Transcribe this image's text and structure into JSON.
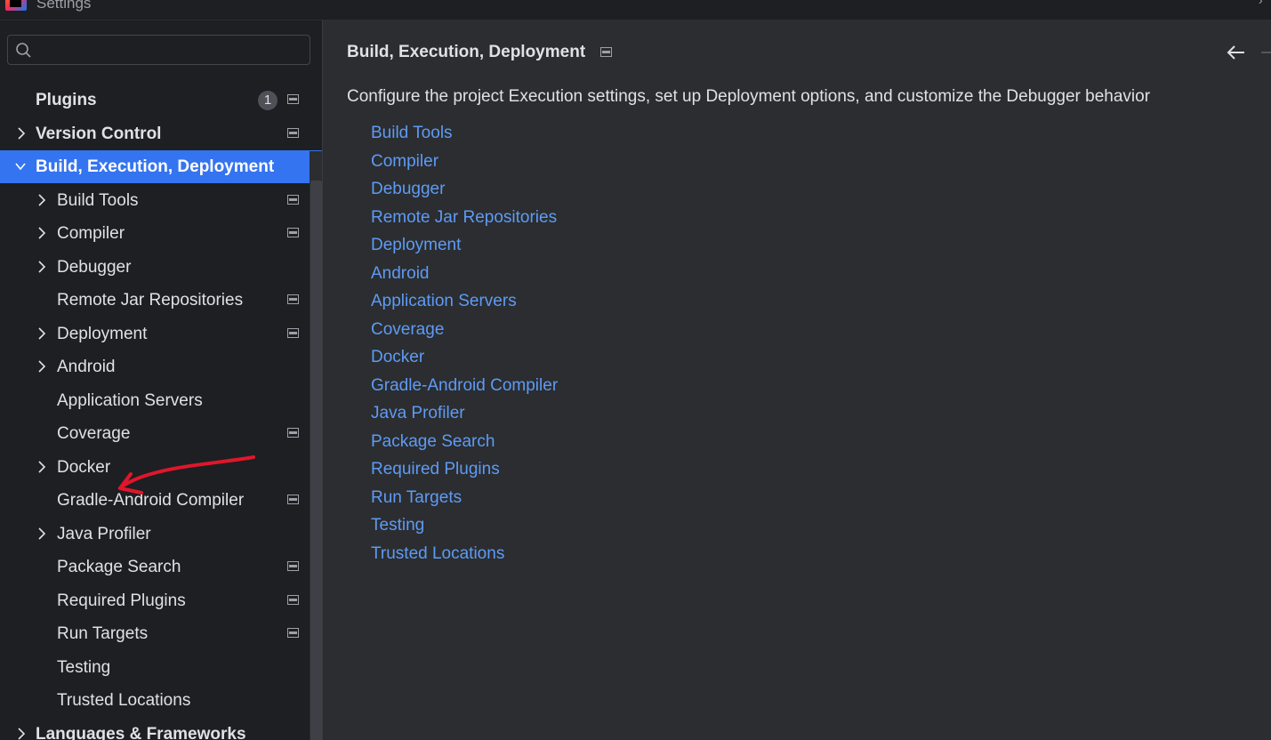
{
  "window": {
    "title": "Settings"
  },
  "search": {
    "placeholder": "",
    "value": ""
  },
  "sidebar": {
    "items": [
      {
        "label": "Plugins",
        "badge": "1"
      },
      {
        "label": "Version Control"
      },
      {
        "label": "Build, Execution, Deployment"
      },
      {
        "label": "Build Tools"
      },
      {
        "label": "Compiler"
      },
      {
        "label": "Debugger"
      },
      {
        "label": "Remote Jar Repositories"
      },
      {
        "label": "Deployment"
      },
      {
        "label": "Android"
      },
      {
        "label": "Application Servers"
      },
      {
        "label": "Coverage"
      },
      {
        "label": "Docker"
      },
      {
        "label": "Gradle-Android Compiler"
      },
      {
        "label": "Java Profiler"
      },
      {
        "label": "Package Search"
      },
      {
        "label": "Required Plugins"
      },
      {
        "label": "Run Targets"
      },
      {
        "label": "Testing"
      },
      {
        "label": "Trusted Locations"
      },
      {
        "label": "Languages & Frameworks"
      }
    ]
  },
  "main": {
    "title": "Build, Execution, Deployment",
    "description": "Configure the project Execution settings, set up Deployment options, and customize the Debugger behavior",
    "links": [
      "Build Tools",
      "Compiler",
      "Debugger",
      "Remote Jar Repositories",
      "Deployment",
      "Android",
      "Application Servers",
      "Coverage",
      "Docker",
      "Gradle-Android Compiler",
      "Java Profiler",
      "Package Search",
      "Required Plugins",
      "Run Targets",
      "Testing",
      "Trusted Locations"
    ]
  },
  "colors": {
    "background": "#1e1f22",
    "panel": "#2b2d30",
    "selection": "#3574f0",
    "link": "#5e9bf5",
    "annotation": "#e0162b"
  },
  "icons": [
    "app-logo-icon",
    "search-icon",
    "chevron-right-icon",
    "chevron-down-icon",
    "project-scope-icon",
    "back-arrow-icon"
  ]
}
